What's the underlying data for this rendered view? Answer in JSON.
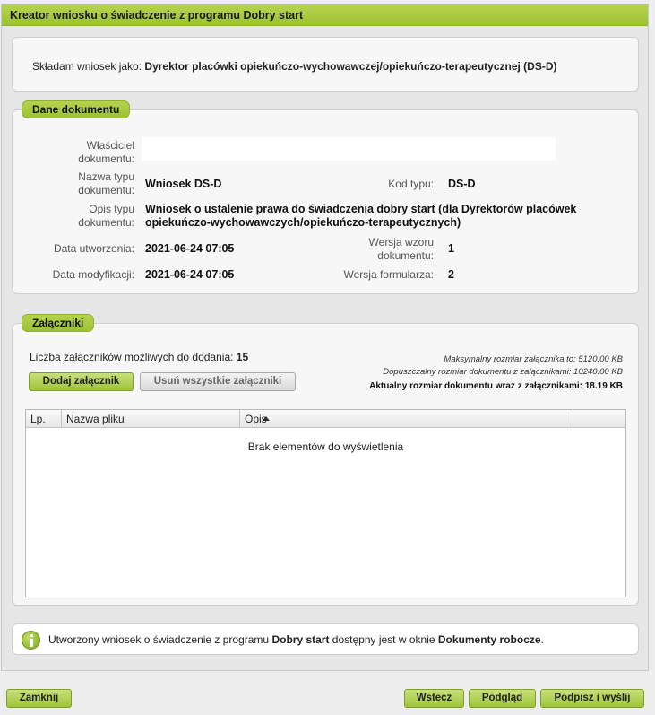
{
  "window": {
    "title": "Kreator wniosku o świadczenie z programu Dobry start"
  },
  "applicant": {
    "prefix": "Składam wniosek jako:",
    "role": "Dyrektor placówki opiekuńczo-wychowawczej/opiekuńczo-terapeutycznej (DS-D)"
  },
  "document": {
    "legend": "Dane dokumentu",
    "owner_label_1": "Właściciel",
    "owner_label_2": "dokumentu:",
    "owner_value": "",
    "type_name_label_1": "Nazwa typu",
    "type_name_label_2": "dokumentu:",
    "type_name_value": "Wniosek DS-D",
    "type_code_label": "Kod typu:",
    "type_code_value": "DS-D",
    "type_desc_label_1": "Opis typu",
    "type_desc_label_2": "dokumentu:",
    "type_desc_value_1": "Wniosek o ustalenie prawa do świadczenia dobry start (dla Dyrektorów placówek",
    "type_desc_value_2": "opiekuńczo-wychowawczych/opiekuńczo-terapeutycznych)",
    "created_label": "Data utworzenia:",
    "created_value": "2021-06-24 07:05",
    "pattern_version_label_1": "Wersja wzoru",
    "pattern_version_label_2": "dokumentu:",
    "pattern_version_value": "1",
    "modified_label": "Data modyfikacji:",
    "modified_value": "2021-06-24 07:05",
    "form_version_label": "Wersja formularza:",
    "form_version_value": "2"
  },
  "attachments": {
    "legend": "Załączniki",
    "count_label": "Liczba załączników możliwych do dodania:",
    "count_value": "15",
    "max_size": "Maksymalny rozmiar załącznika to: 5120.00 KB",
    "allowed_size": "Dopuszczalny rozmiar dokumentu z załącznikami: 10240.00 KB",
    "current_size": "Aktualny rozmiar dokumentu wraz z załącznikami: 18.19 KB",
    "add_button": "Dodaj załącznik",
    "remove_all_button": "Usuń wszystkie załączniki",
    "columns": [
      "Lp.",
      "Nazwa pliku",
      "Opis",
      ""
    ],
    "rows": [],
    "empty_message": "Brak elementów do wyświetlenia"
  },
  "notice": {
    "text_1": "Utworzony wniosek o świadczenie z programu ",
    "bold_1": "Dobry start",
    "text_2": " dostępny jest w oknie ",
    "bold_2": "Dokumenty robocze",
    "text_3": "."
  },
  "footer": {
    "close_button": "Zamknij",
    "back_button": "Wstecz",
    "preview_button": "Podgląd",
    "sign_send_button": "Podpisz i wyślij"
  },
  "colors": {
    "accent_green": "#9cc234",
    "panel_bg": "#f7f7f7"
  }
}
